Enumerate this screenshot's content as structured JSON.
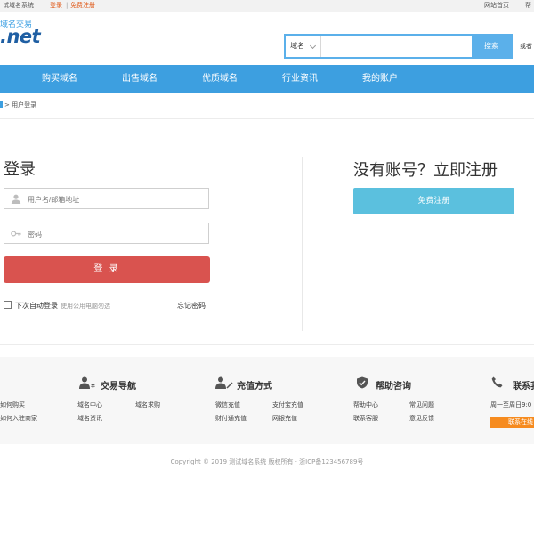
{
  "topbar": {
    "site_name": "试域名系统",
    "login": "登录",
    "separator": "|",
    "register": "免费注册",
    "home_link": "网站首页",
    "help_link": "帮"
  },
  "header": {
    "logo_top": "域名交易",
    "logo_main": ".net",
    "search": {
      "select_value": "域名",
      "input_value": "",
      "button_label": "搜索"
    },
    "or_text": "或者"
  },
  "nav": {
    "items": [
      "购买域名",
      "出售域名",
      "优质域名",
      "行业资讯",
      "我的账户"
    ]
  },
  "breadcrumb": {
    "separator": ">",
    "current": "用户登录"
  },
  "login": {
    "title": "登录",
    "username_placeholder": "用户名/邮箱地址",
    "password_placeholder": "密码",
    "submit_label": "登 录",
    "remember_label": "下次自动登录",
    "remember_hint": "使用公用电脑勿选",
    "forgot_label": "忘记密码"
  },
  "register": {
    "title": "没有账号？立即注册",
    "button_label": "免费注册"
  },
  "footer": {
    "col_left": [
      "如何购买",
      "如何入驻商家"
    ],
    "trade": {
      "title": "交易导航",
      "links": [
        "域名中心",
        "域名求购",
        "域名资讯"
      ]
    },
    "recharge": {
      "title": "充值方式",
      "links": [
        "微信充值",
        "支付宝充值",
        "财付通充值",
        "网银充值"
      ]
    },
    "help": {
      "title": "帮助咨询",
      "links": [
        "帮助中心",
        "常见问题",
        "联系客服",
        "意见反馈"
      ]
    },
    "contact": {
      "title": "联系我",
      "hours": "周一至周日9:0",
      "button_label": "联系在线"
    }
  },
  "copyright": "Copyright © 2019 测试域名系统 版权所有 · 浙ICP备123456789号",
  "colors": {
    "accent": "#3d9fe0",
    "search_button": "#5bb0ea",
    "login_button": "#d9534f",
    "register_button": "#5bc0de",
    "contact_button": "#f68b1f",
    "topbar_link": "#e05a1a"
  }
}
